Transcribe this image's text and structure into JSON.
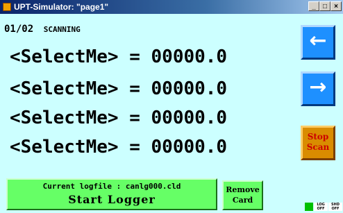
{
  "window": {
    "title": "UPT-Simulator: \"page1\""
  },
  "window_buttons": {
    "minimize": "_",
    "maximize": "□",
    "close": "×"
  },
  "status": {
    "page": "01/02",
    "state": "SCANNING"
  },
  "readings": [
    {
      "label": "<SelectMe>",
      "eq": "=",
      "value": "00000.0"
    },
    {
      "label": "<SelectMe>",
      "eq": "=",
      "value": "00000.0"
    },
    {
      "label": "<SelectMe>",
      "eq": "=",
      "value": "00000.0"
    },
    {
      "label": "<SelectMe>",
      "eq": "=",
      "value": "00000.0"
    }
  ],
  "nav": {
    "prev_glyph": "←",
    "next_glyph": "→"
  },
  "stop_scan": {
    "line1": "Stop",
    "line2": "Scan"
  },
  "logger": {
    "logfile_text": "Current logfile : canlg000.cld",
    "button_label": "Start Logger"
  },
  "remove_card": {
    "line1": "Remove",
    "line2": "Card"
  },
  "indicators": {
    "log": "LOG",
    "log_state": "OFF",
    "shd": "SHD",
    "shd_state": "OFF"
  },
  "colors": {
    "background": "#ccffff",
    "nav_button": "#1e90ff",
    "stop_button": "#d98c00",
    "logger_button": "#66ff66"
  }
}
